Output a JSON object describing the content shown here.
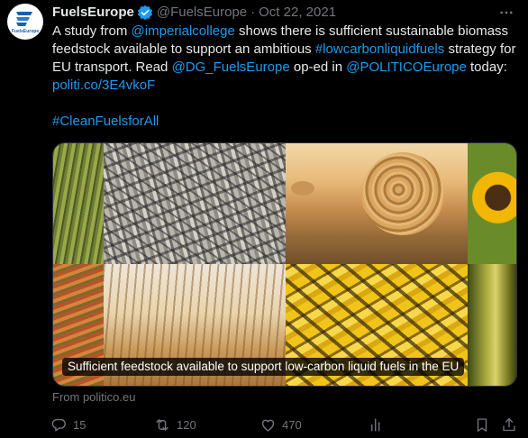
{
  "tweet": {
    "display_name": "FuelsEurope",
    "avatar_text": "FuelsEurope",
    "handle": "@FuelsEurope",
    "separator": "·",
    "date": "Oct 22, 2021",
    "text": {
      "p1": "A study from ",
      "mention1": "@imperialcollege",
      "p2": " shows there is sufficient sustainable biomass feedstock available to support an ambitious ",
      "hashtag1": "#lowcarbonliquidfuels",
      "p3": " strategy for EU transport. Read ",
      "mention2": "@DG_FuelsEurope",
      "p4": " op-ed in ",
      "mention3": "@POLITICOEurope",
      "p5": " today: ",
      "link": "politi.co/3E4vkoF",
      "hashtag2": "#CleanFuelsforAll"
    },
    "media": {
      "caption": "Sufficient feedstock available to support low-carbon liquid fuels in the EU"
    },
    "source": "From politico.eu",
    "actions": {
      "replies": "15",
      "retweets": "120",
      "likes": "470"
    }
  },
  "colors": {
    "background": "#000000",
    "text": "#e7e9ea",
    "muted": "#71767b",
    "link": "#1d9bf0",
    "verified": "#1d9bf0"
  }
}
